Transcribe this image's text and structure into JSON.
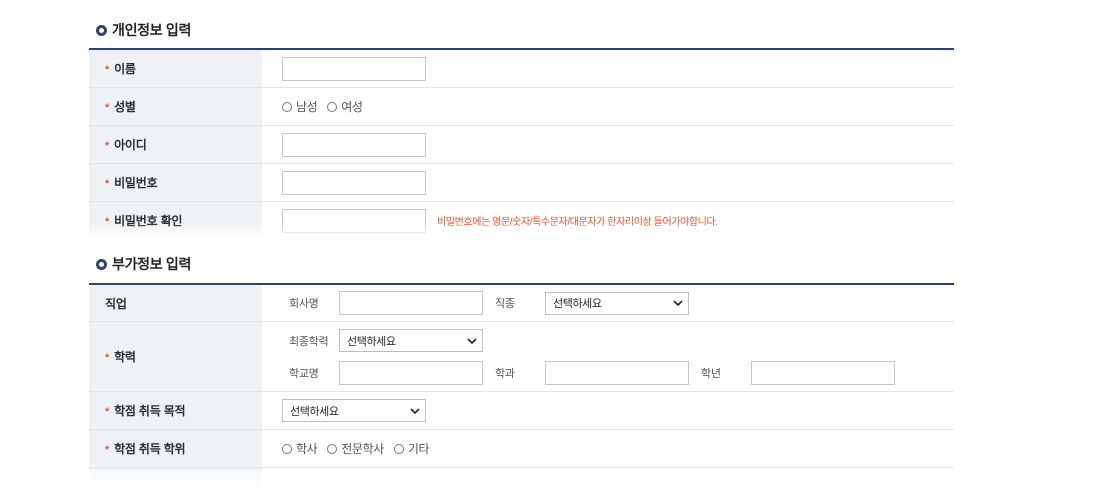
{
  "required_mark": "*",
  "colors": {
    "navy": "#2f4468",
    "required": "#e8552b",
    "label_bg": "#eef2f7",
    "row_line": "#e1e4e8"
  },
  "personal": {
    "title": "개인정보 입력",
    "name": {
      "label": "이름",
      "value": ""
    },
    "gender": {
      "label": "성별",
      "options": [
        "남성",
        "여성"
      ]
    },
    "user_id": {
      "label": "아이디",
      "value": ""
    },
    "password": {
      "label": "비밀번호",
      "value": ""
    },
    "password_confirm": {
      "label": "비밀번호 확인",
      "value": "",
      "hint": "비밀번호에는 영문/숫자/특수문자/대문자가 한자리이상 들어가야합니다."
    }
  },
  "additional": {
    "title": "부가정보 입력",
    "job": {
      "label": "직업",
      "company": {
        "label": "회사명",
        "value": ""
      },
      "job_type": {
        "label": "직종",
        "selected": "선택하세요"
      }
    },
    "education": {
      "label": "학력",
      "final_degree": {
        "label": "최종학력",
        "selected": "선택하세요"
      },
      "school": {
        "label": "학교명",
        "value": ""
      },
      "major": {
        "label": "학과",
        "value": ""
      },
      "grade": {
        "label": "학년",
        "value": ""
      }
    },
    "credit_purpose": {
      "label": "학점 취득 목적",
      "selected": "선택하세요"
    },
    "credit_degree": {
      "label": "학점 취득 학위",
      "options": [
        "학사",
        "전문학사",
        "기타"
      ]
    }
  }
}
